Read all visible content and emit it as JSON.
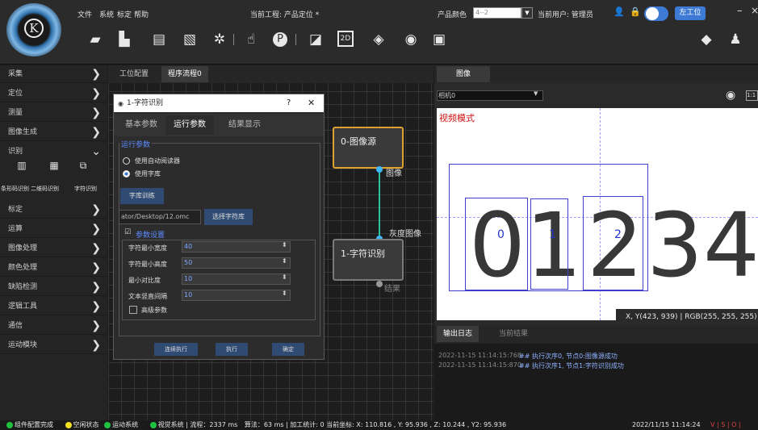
{
  "menu": {
    "file": "文件",
    "system": "系统",
    "calibration": "标定",
    "help": "帮助",
    "project": "当前工程: 产品定位 *",
    "product_color_label": "产品颜色",
    "product_color_value": "4--2",
    "user": "当前用户: 管理员",
    "workstation": "左工位"
  },
  "toolbar_icons": [
    "folder-icon",
    "new-file-icon",
    "save-icon",
    "save-as-icon",
    "settings-icon",
    "touch-icon",
    "p-icon",
    "chart-icon",
    "2d-icon",
    "3d-icon",
    "camera-icon",
    "alert-icon",
    "user-settings-icon"
  ],
  "sidebar": {
    "items": [
      {
        "label": "采集"
      },
      {
        "label": "定位"
      },
      {
        "label": "测量"
      },
      {
        "label": "图像生成"
      },
      {
        "label": "识别"
      },
      {
        "label": "标定"
      },
      {
        "label": "运算"
      },
      {
        "label": "图像处理"
      },
      {
        "label": "颜色处理"
      },
      {
        "label": "缺陷检测"
      },
      {
        "label": "逻辑工具"
      },
      {
        "label": "通信"
      },
      {
        "label": "运动模块"
      }
    ],
    "sub_tools": [
      "条形码识别",
      "二维码识别",
      "字符识别"
    ]
  },
  "tabs": [
    "工位配置",
    "程序流程0"
  ],
  "dialog": {
    "title": "1-字符识别",
    "help": "?",
    "close": "✕",
    "tabs": [
      "基本参数",
      "运行参数",
      "结果显示"
    ],
    "group": "运行参数",
    "radio1": "使用自动阅读器",
    "radio2": "使用字库",
    "train_btn": "字库训练",
    "path": "ator/Desktop/12.omc",
    "select_btn": "选择字符库",
    "param_group": "参数设置",
    "params": [
      {
        "label": "字符最小宽度",
        "value": "40"
      },
      {
        "label": "字符最小高度",
        "value": "50"
      },
      {
        "label": "最小对比度",
        "value": "10"
      },
      {
        "label": "文本竖直间隔",
        "value": "10"
      }
    ],
    "advanced": "高级参数",
    "btn_continuous": "连续执行",
    "btn_run": "执行",
    "btn_ok": "确定"
  },
  "nodes": {
    "source": "0-图像源",
    "source_out": "图像",
    "ocr": "1-字符识别",
    "ocr_in": "灰度图像",
    "ocr_out": "结果"
  },
  "image_panel": {
    "tab": "图像",
    "camera": "相机0",
    "mode": "视频模式",
    "zoom": "1:1",
    "digits": [
      "0",
      "1",
      "2",
      "3",
      "4"
    ],
    "box_labels": [
      "0",
      "1",
      "2"
    ],
    "coords": "X, Y(423, 939) | RGB(255, 255, 255)"
  },
  "log": {
    "tabs": [
      "输出日志",
      "当前结果"
    ],
    "lines": [
      {
        "time": "2022-11-15 11:14:15:768",
        "text": "## 执行次序0, 节点0:图像源成功"
      },
      {
        "time": "2022-11-15 11:14:15:870",
        "text": "## 执行次序1, 节点1:字符识别成功"
      }
    ]
  },
  "status": {
    "config": "组件配置完成",
    "idle": "空闲状态",
    "motion": "运动系统",
    "vision": "视觉系统",
    "flow": "| 流程：2337 ms",
    "algo": "算法：63 ms | 加工统计: 0 当前坐标: X: 110.816 , Y: 95.936 , Z: 10.244 , Y2: 95.936",
    "datetime": "2022/11/15 11:14:24",
    "flags": "V | S | O |"
  },
  "colors": {
    "accent": "#3d7ad6",
    "port": "#3fb8ff",
    "node_border_active": "#e0a030",
    "mode_text": "#d01010"
  }
}
